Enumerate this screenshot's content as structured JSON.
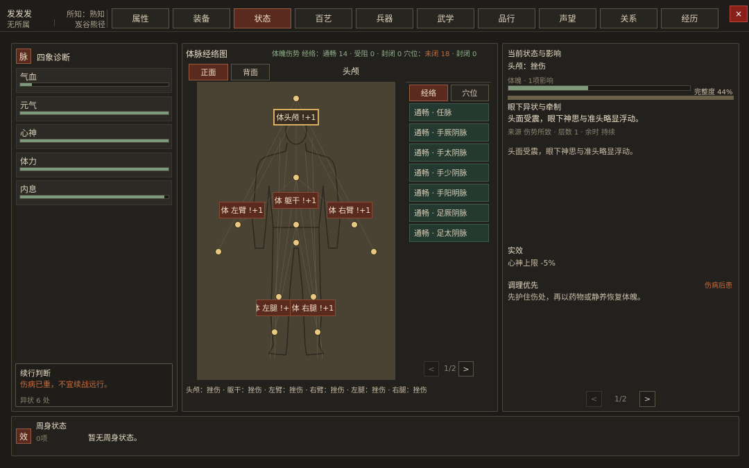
{
  "top": {
    "name": "发发发",
    "faction": "无所属",
    "known_label": "所知：熟知",
    "known_place": "岌谷熊径",
    "tabs": [
      "属性",
      "装备",
      "状态",
      "百艺",
      "兵器",
      "武学",
      "品行",
      "声望",
      "关系",
      "经历"
    ],
    "active_tab": "状态",
    "close": "×"
  },
  "left": {
    "badge": "脉",
    "title": "四象诊断",
    "stats": [
      {
        "label": "气血",
        "fraction": 0.08
      },
      {
        "label": "元气",
        "fraction": 1.0
      },
      {
        "label": "心神",
        "fraction": 1.0
      },
      {
        "label": "体力",
        "fraction": 1.0
      },
      {
        "label": "内息",
        "fraction": 0.97
      }
    ],
    "judge": {
      "title": "续行判断",
      "desc": "伤病已重，不宜续战远行。",
      "count": "异状 6 处"
    }
  },
  "center": {
    "title": "体脉经络图",
    "status_prefix": "体魄伤势 经络：通畅 14 · 受阻 0 · 封闭 0 穴位：",
    "status_highlight": "未闭 18",
    "status_suffix": " · 封闭 0",
    "front": "正面",
    "back": "背面",
    "region_title": "头颅",
    "labels": {
      "head": "体头颅  !+1",
      "torso": "体 躯干 !+1",
      "larm": "体 左臂 !+1",
      "rarm": "体 右臂 !+1",
      "lleg": "体 左腿 !+1",
      "rleg": "体 右腿 !+1"
    },
    "list_tabs": {
      "meridian": "经络",
      "acupoint": "穴位"
    },
    "meridians": [
      "通畅 · 任脉",
      "通畅 · 手厥阴脉",
      "通畅 · 手太阴脉",
      "通畅 · 手少阴脉",
      "通畅 · 手阳明脉",
      "通畅 · 足厥阴脉",
      "通畅 · 足太阴脉"
    ],
    "pager": {
      "prev": "<",
      "page": "1/2",
      "next": ">"
    },
    "summary": "头颅：挫伤 · 躯干：挫伤 · 左臂：挫伤 · 右臂：挫伤 · 左腿：挫伤 · 右腿：挫伤"
  },
  "right": {
    "title": "当前状态与影响",
    "subtitle": "头颅：挫伤",
    "impact": "体魄 · 1项影响",
    "integrity_label": "完整度 44%",
    "integrity": 0.44,
    "section": "眼下异状与牵制",
    "headline": "头面受震，眼下神思与准头略显浮动。",
    "source": "来源 伤势所致 · 层数 1 · 余时 持续",
    "desc": "头面受震，眼下神思与准头略显浮动。",
    "effect_title": "实效",
    "effect": "心神上限 -5%",
    "priority_title": "调理优先",
    "priority_tag": "伤病后患",
    "priority_desc": "先护住伤处，再以药物或静养恢复体魄。",
    "pager": {
      "prev": "<",
      "page": "1/2",
      "next": ">"
    }
  },
  "bottom": {
    "badge": "效",
    "title": "周身状态",
    "count": "0项",
    "empty": "暂无周身状态。"
  },
  "colors": {
    "accent": "#5a2a1e",
    "meridian": "#24392f",
    "bar": "#7e9a7c",
    "warn": "#c96a3a"
  }
}
